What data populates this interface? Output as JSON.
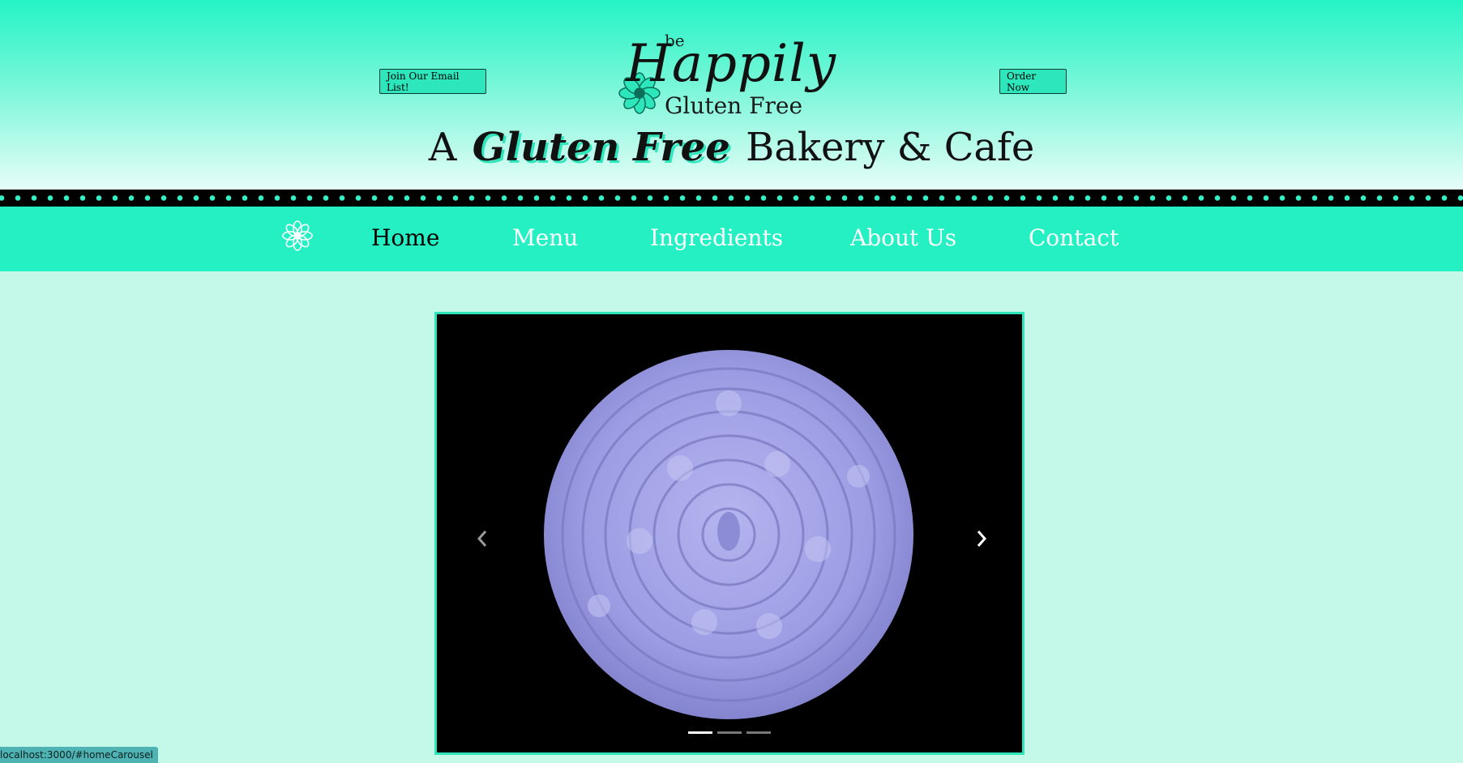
{
  "header": {
    "email_button": "Join Our Email List!",
    "order_button": "Order Now",
    "logo": {
      "be": "be",
      "happily": "Happily",
      "gluten_free": "Gluten Free"
    },
    "tagline": {
      "prefix": "A",
      "script": "Gluten Free",
      "suffix": "Bakery & Cafe"
    }
  },
  "nav": {
    "icon": "flower-icon",
    "items": [
      {
        "label": "Home",
        "active": true
      },
      {
        "label": "Menu",
        "active": false
      },
      {
        "label": "Ingredients",
        "active": false
      },
      {
        "label": "About Us",
        "active": false
      },
      {
        "label": "Contact",
        "active": false
      }
    ]
  },
  "carousel": {
    "prev_icon": "chevron-left-icon",
    "next_icon": "chevron-right-icon",
    "slide_count": 3,
    "active_index": 0
  },
  "status_bar": {
    "url": "localhost:3000/#homeCarousel"
  },
  "colors": {
    "accent": "#24f0c3",
    "page_bg": "#c4f9e9",
    "flower_purple": "#9f9fe6"
  }
}
